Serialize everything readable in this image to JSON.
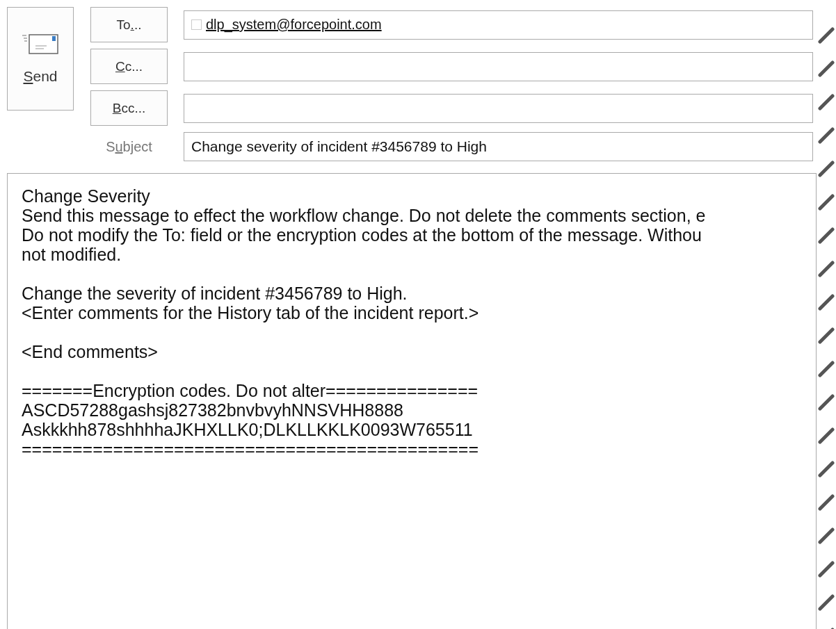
{
  "send_button": {
    "label_parts": [
      {
        "text": "S",
        "underlined": true
      },
      {
        "text": "end",
        "underlined": false
      }
    ]
  },
  "address_rows": [
    {
      "button": {
        "label_parts": [
          {
            "text": "To",
            "underlined": false
          },
          {
            "text": ".",
            "underlined": true
          },
          {
            "text": "..",
            "underlined": false
          }
        ]
      },
      "recipients": [
        {
          "address": "dlp_system@forcepoint.com",
          "checked": false
        }
      ]
    },
    {
      "button": {
        "label_parts": [
          {
            "text": "C",
            "underlined": true
          },
          {
            "text": "c...",
            "underlined": false
          }
        ]
      },
      "recipients": []
    },
    {
      "button": {
        "label_parts": [
          {
            "text": "B",
            "underlined": true
          },
          {
            "text": "cc...",
            "underlined": false
          }
        ]
      },
      "recipients": []
    }
  ],
  "subject": {
    "label_parts": [
      {
        "text": "S",
        "underlined": false
      },
      {
        "text": "u",
        "underlined": true
      },
      {
        "text": "bject",
        "underlined": false
      }
    ],
    "value": "Change severity of incident #3456789 to High"
  },
  "body": {
    "paragraphs": [
      [
        "Change Severity",
        "Send this message to effect the workflow change. Do not delete the comments section, e",
        "Do not modify the To: field or the encryption codes at the bottom of the message. Withou",
        "not modified."
      ],
      [
        "Change the severity of incident #3456789 to High.",
        "<Enter comments for the History tab of the incident report.>"
      ],
      [
        "<End comments>"
      ],
      [
        "=======Encryption codes. Do not alter===============",
        "ASCD57288gashsj827382bnvbvyhNNSVHH8888",
        "Askkkhh878shhhhaJKHXLLK0;DLKLLKKLK0093W765511",
        "============================================="
      ]
    ]
  }
}
